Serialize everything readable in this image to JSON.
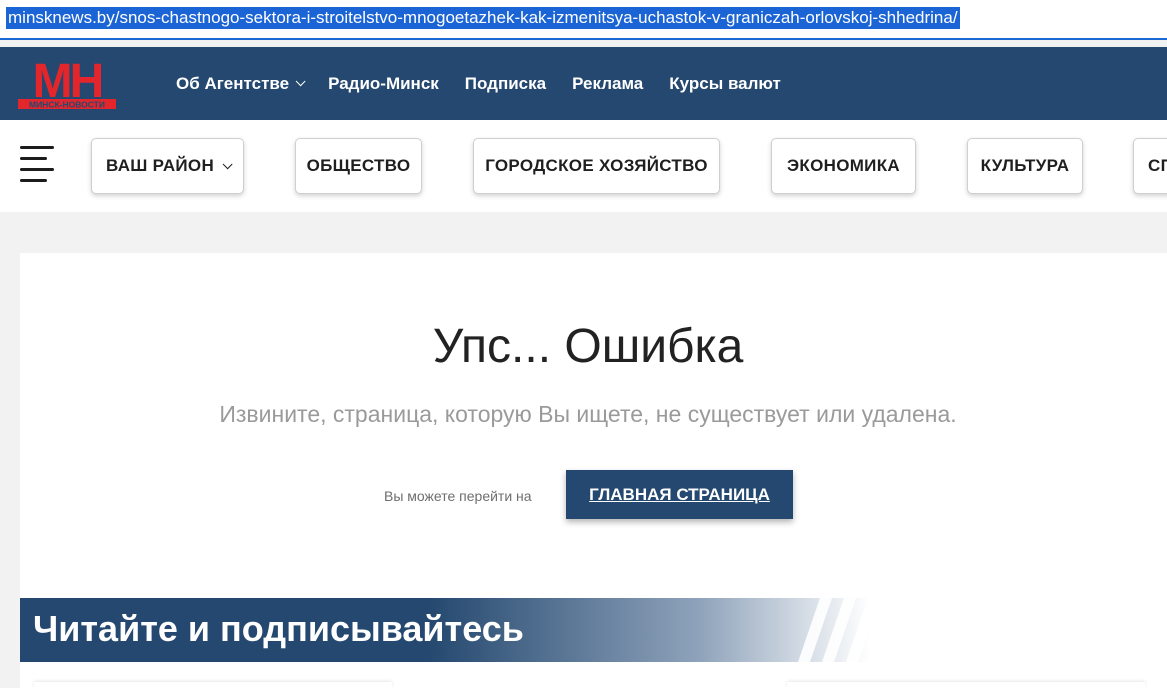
{
  "browser": {
    "url": "minsknews.by/snos-chastnogo-sektora-i-stroitelstvo-mnogoetazhek-kak-izmenitsya-uchastok-v-graniczah-orlovskoj-shhedrina/"
  },
  "header": {
    "logo": {
      "letters": "МН",
      "caption": "МИНСК-НОВОСТИ"
    },
    "nav": [
      {
        "label": "Об Агентстве",
        "has_dropdown": true
      },
      {
        "label": "Радио-Минск"
      },
      {
        "label": "Подписка"
      },
      {
        "label": "Реклама"
      },
      {
        "label": "Курсы валют"
      }
    ]
  },
  "categories": [
    {
      "label": "ВАШ РАЙОН",
      "has_dropdown": true
    },
    {
      "label": "ОБЩЕСТВО"
    },
    {
      "label": "ГОРОДСКОЕ ХОЗЯЙСТВО"
    },
    {
      "label": "ЭКОНОМИКА"
    },
    {
      "label": "КУЛЬТУРА"
    },
    {
      "label": "СП"
    }
  ],
  "error": {
    "title": "Упс... Ошибка",
    "subtitle": "Извините, страница, которую Вы ищете, не существует или удалена.",
    "goto_text": "Вы можете перейти на",
    "home_button": "ГЛАВНАЯ СТРАНИЦА"
  },
  "banner": {
    "title": "Читайте и подписывайтесь"
  },
  "colors": {
    "brand_blue": "#24486f",
    "logo_red": "#e3262b",
    "url_highlight": "#1b64d6"
  }
}
